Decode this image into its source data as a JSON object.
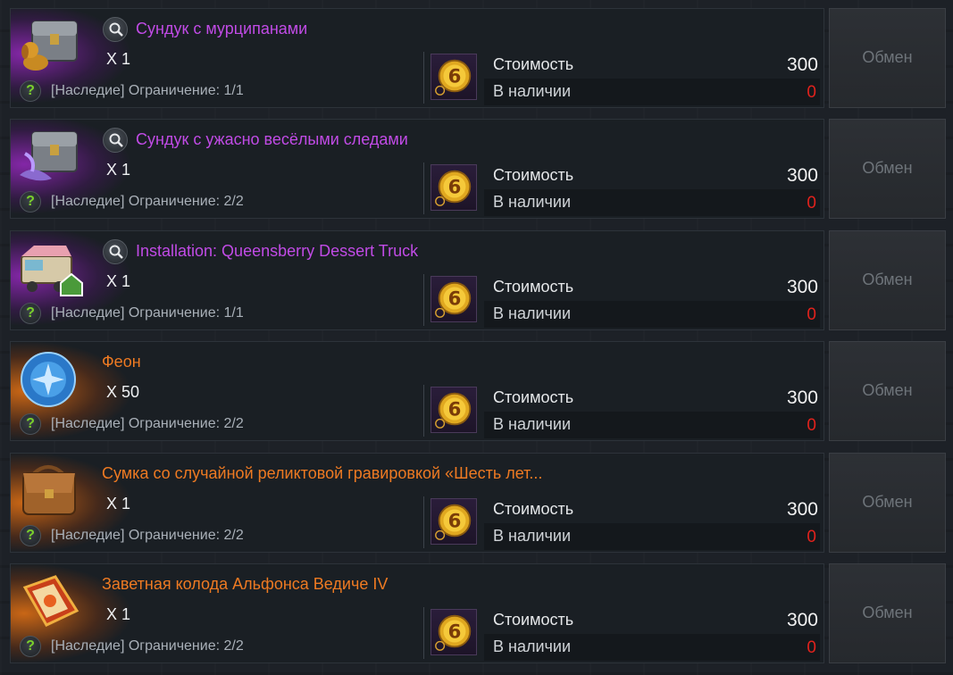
{
  "labels": {
    "cost": "Стоимость",
    "stock": "В наличии",
    "exchange": "Обмен"
  },
  "colors": {
    "purple_name": "#c14be6",
    "orange_name": "#ee7a22",
    "stock_zero": "#e2221c"
  },
  "items": [
    {
      "name": "Сундук с мурципанами",
      "quantity": "X 1",
      "limit": "[Наследие] Ограничение: 1/1",
      "cost": "300",
      "stock": "0",
      "rarity": "purple",
      "icon": "chest-with-dog-icon"
    },
    {
      "name": "Сундук с ужасно весёлыми следами",
      "quantity": "X 1",
      "limit": "[Наследие] Ограничение: 2/2",
      "cost": "300",
      "stock": "0",
      "rarity": "purple",
      "icon": "chest-with-footprints-icon"
    },
    {
      "name": "Installation: Queensberry Dessert Truck",
      "quantity": "X 1",
      "limit": "[Наследие] Ограничение: 1/1",
      "cost": "300",
      "stock": "0",
      "rarity": "purple",
      "icon": "dessert-truck-icon"
    },
    {
      "name": "Феон",
      "quantity": "X 50",
      "limit": "[Наследие] Ограничение: 2/2",
      "cost": "300",
      "stock": "0",
      "rarity": "orange",
      "icon": "blue-crystal-orb-icon"
    },
    {
      "name": "Сумка со случайной реликтовой гравировкой «Шесть лет...",
      "quantity": "X 1",
      "limit": "[Наследие] Ограничение: 2/2",
      "cost": "300",
      "stock": "0",
      "rarity": "orange",
      "icon": "leather-satchel-icon"
    },
    {
      "name": "Заветная колода Альфонса Ведиче IV",
      "quantity": "X 1",
      "limit": "[Наследие] Ограничение: 2/2",
      "cost": "300",
      "stock": "0",
      "rarity": "orange",
      "icon": "card-deck-book-icon"
    }
  ]
}
